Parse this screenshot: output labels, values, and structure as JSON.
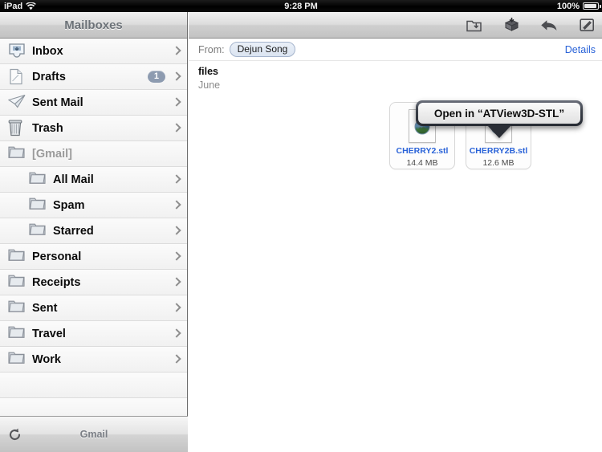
{
  "status_bar": {
    "device": "iPad",
    "wifi_icon": "wifi-icon",
    "time": "9:28 PM",
    "battery_percent": "100%",
    "battery_icon": "battery-icon"
  },
  "sidebar": {
    "title": "Mailboxes",
    "items": [
      {
        "label": "Inbox",
        "icon": "inbox-icon",
        "indent": false,
        "muted": false,
        "badge": "",
        "chevron": true
      },
      {
        "label": "Drafts",
        "icon": "drafts-icon",
        "indent": false,
        "muted": false,
        "badge": "1",
        "chevron": true
      },
      {
        "label": "Sent Mail",
        "icon": "sent-mail-icon",
        "indent": false,
        "muted": false,
        "badge": "",
        "chevron": true
      },
      {
        "label": "Trash",
        "icon": "trash-icon",
        "indent": false,
        "muted": false,
        "badge": "",
        "chevron": true
      },
      {
        "label": "[Gmail]",
        "icon": "folder-icon",
        "indent": false,
        "muted": true,
        "badge": "",
        "chevron": false
      },
      {
        "label": "All Mail",
        "icon": "folder-icon",
        "indent": true,
        "muted": false,
        "badge": "",
        "chevron": true
      },
      {
        "label": "Spam",
        "icon": "folder-icon",
        "indent": true,
        "muted": false,
        "badge": "",
        "chevron": true
      },
      {
        "label": "Starred",
        "icon": "folder-icon",
        "indent": true,
        "muted": false,
        "badge": "",
        "chevron": true
      },
      {
        "label": "Personal",
        "icon": "folder-icon",
        "indent": false,
        "muted": false,
        "badge": "",
        "chevron": true
      },
      {
        "label": "Receipts",
        "icon": "folder-icon",
        "indent": false,
        "muted": false,
        "badge": "",
        "chevron": true
      },
      {
        "label": "Sent",
        "icon": "folder-icon",
        "indent": false,
        "muted": false,
        "badge": "",
        "chevron": true
      },
      {
        "label": "Travel",
        "icon": "folder-icon",
        "indent": false,
        "muted": false,
        "badge": "",
        "chevron": true
      },
      {
        "label": "Work",
        "icon": "folder-icon",
        "indent": false,
        "muted": false,
        "badge": "",
        "chevron": true
      },
      {
        "label": "",
        "icon": "",
        "indent": false,
        "muted": false,
        "badge": "",
        "chevron": false
      },
      {
        "label": "",
        "icon": "",
        "indent": false,
        "muted": false,
        "badge": "",
        "chevron": false
      }
    ],
    "footer": {
      "refresh_icon": "refresh-icon",
      "account_label": "Gmail"
    }
  },
  "message": {
    "toolbar": [
      {
        "icon": "move-to-folder-icon"
      },
      {
        "icon": "archive-icon"
      },
      {
        "icon": "reply-icon"
      },
      {
        "icon": "compose-icon"
      }
    ],
    "from_label": "From:",
    "sender": "Dejun Song",
    "details_label": "Details",
    "subject": "files",
    "date": "June",
    "attachments": [
      {
        "name": "CHERRY2.stl",
        "size": "14.4 MB",
        "icon": "stl-file-icon"
      },
      {
        "name": "CHERRY2B.stl",
        "size": "12.6 MB",
        "icon": "stl-file-icon"
      }
    ]
  },
  "popup": {
    "label": "Open in “ATView3D-STL”"
  },
  "colors": {
    "link": "#2a63d8",
    "badge": "#8d9bb0",
    "navbar_title": "#6c7278"
  }
}
